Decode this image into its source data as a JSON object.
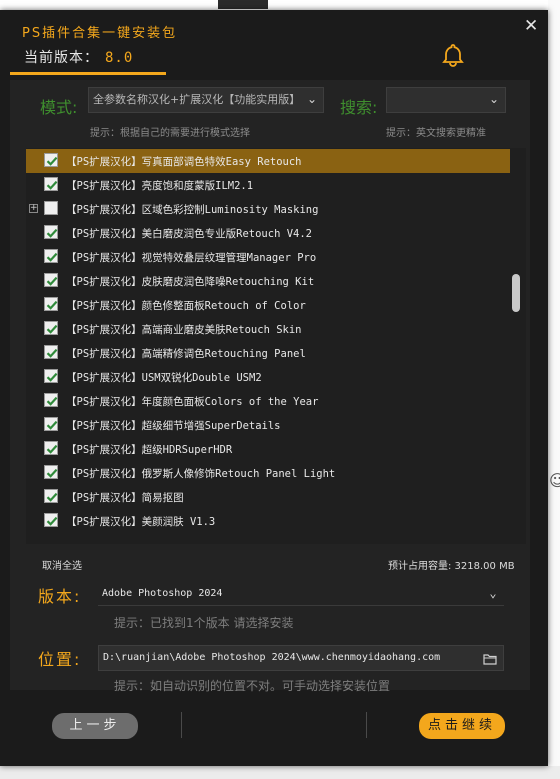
{
  "window": {
    "title": "PS插件合集一键安装包",
    "version_label": "当前版本：",
    "version_value": "8.0",
    "close_glyph": "✕"
  },
  "mode": {
    "label": "模式:",
    "selected": "全参数名称汉化+扩展汉化【功能实用版】",
    "hint": "提示：根据自己的需要进行模式选择"
  },
  "search": {
    "label": "搜索:",
    "value": "",
    "hint": "提示：英文搜索更精准"
  },
  "list": {
    "items": [
      {
        "text": "【PS扩展汉化】写真面部调色特效Easy Retouch",
        "checked": true,
        "selected": true,
        "expandable": false
      },
      {
        "text": "【PS扩展汉化】亮度饱和度蒙版ILM2.1",
        "checked": true,
        "selected": false,
        "expandable": false
      },
      {
        "text": "【PS扩展汉化】区域色彩控制Luminosity Masking",
        "checked": false,
        "selected": false,
        "expandable": true
      },
      {
        "text": "【PS扩展汉化】美白磨皮润色专业版Retouch V4.2",
        "checked": true,
        "selected": false,
        "expandable": false
      },
      {
        "text": "【PS扩展汉化】视觉特效叠层纹理管理Manager Pro",
        "checked": true,
        "selected": false,
        "expandable": false
      },
      {
        "text": "【PS扩展汉化】皮肤磨皮润色降噪Retouching Kit",
        "checked": true,
        "selected": false,
        "expandable": false
      },
      {
        "text": "【PS扩展汉化】颜色修整面板Retouch of Color",
        "checked": true,
        "selected": false,
        "expandable": false
      },
      {
        "text": "【PS扩展汉化】高端商业磨皮美肤Retouch Skin",
        "checked": true,
        "selected": false,
        "expandable": false
      },
      {
        "text": "【PS扩展汉化】高端精修调色Retouching Panel",
        "checked": true,
        "selected": false,
        "expandable": false
      },
      {
        "text": "【PS扩展汉化】USM双锐化Double USM2",
        "checked": true,
        "selected": false,
        "expandable": false
      },
      {
        "text": "【PS扩展汉化】年度颜色面板Colors of the Year",
        "checked": true,
        "selected": false,
        "expandable": false
      },
      {
        "text": "【PS扩展汉化】超级细节增强SuperDetails",
        "checked": true,
        "selected": false,
        "expandable": false
      },
      {
        "text": "【PS扩展汉化】超级HDRSuperHDR",
        "checked": true,
        "selected": false,
        "expandable": false
      },
      {
        "text": "【PS扩展汉化】俄罗斯人像修饰Retouch Panel Light",
        "checked": true,
        "selected": false,
        "expandable": false
      },
      {
        "text": "【PS扩展汉化】简易抠图",
        "checked": true,
        "selected": false,
        "expandable": false
      },
      {
        "text": "【PS扩展汉化】美颜润肤 V1.3",
        "checked": true,
        "selected": false,
        "expandable": false
      }
    ],
    "deselect_label": "取消全选",
    "estimate": "预计占用容量: 3218.00 MB"
  },
  "version": {
    "label": "版本:",
    "selected": "Adobe Photoshop 2024",
    "hint": "提示：已找到1个版本 请选择安装"
  },
  "location": {
    "label": "位置:",
    "path": "D:\\ruanjian\\Adobe Photoshop 2024\\www.chenmoyidaohang.com",
    "hint": "提示：如自动识别的位置不对。可手动选择安装位置"
  },
  "footer": {
    "back_label": "上一步",
    "next_label": "点击继续"
  },
  "colors": {
    "accent": "#f3a71c",
    "green_label": "#3f8f2e",
    "selected_row": "#8a6212",
    "check_green": "#2f8a3a"
  },
  "icons": {
    "bell": "bell-icon",
    "close": "close-icon",
    "folder": "folder-icon",
    "chevron": "chevron-down-icon"
  }
}
